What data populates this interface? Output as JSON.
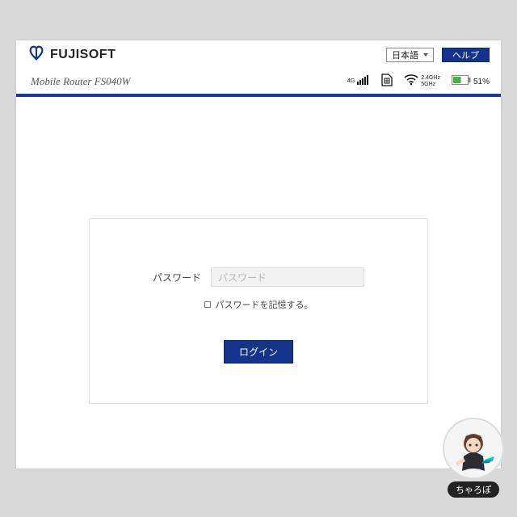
{
  "header": {
    "brand_name": "FUJISOFT",
    "language_selected": "日本語",
    "help_label": "ヘルプ"
  },
  "subheader": {
    "subtitle": "Mobile Router FS040W"
  },
  "status": {
    "cell_label": "4G",
    "wifi_band1": "2.4GHz",
    "wifi_band2": "5GHz",
    "battery_pct": "51%"
  },
  "login": {
    "password_label": "パスワード",
    "password_placeholder": "パスワード",
    "remember_label": "パスワードを記憶する。",
    "submit_label": "ログイン"
  },
  "watermark": {
    "name": "ちゃろぽ"
  },
  "colors": {
    "accent": "#14348b",
    "divider": "#1a3a9a",
    "battery_fill": "#3fb53a"
  }
}
